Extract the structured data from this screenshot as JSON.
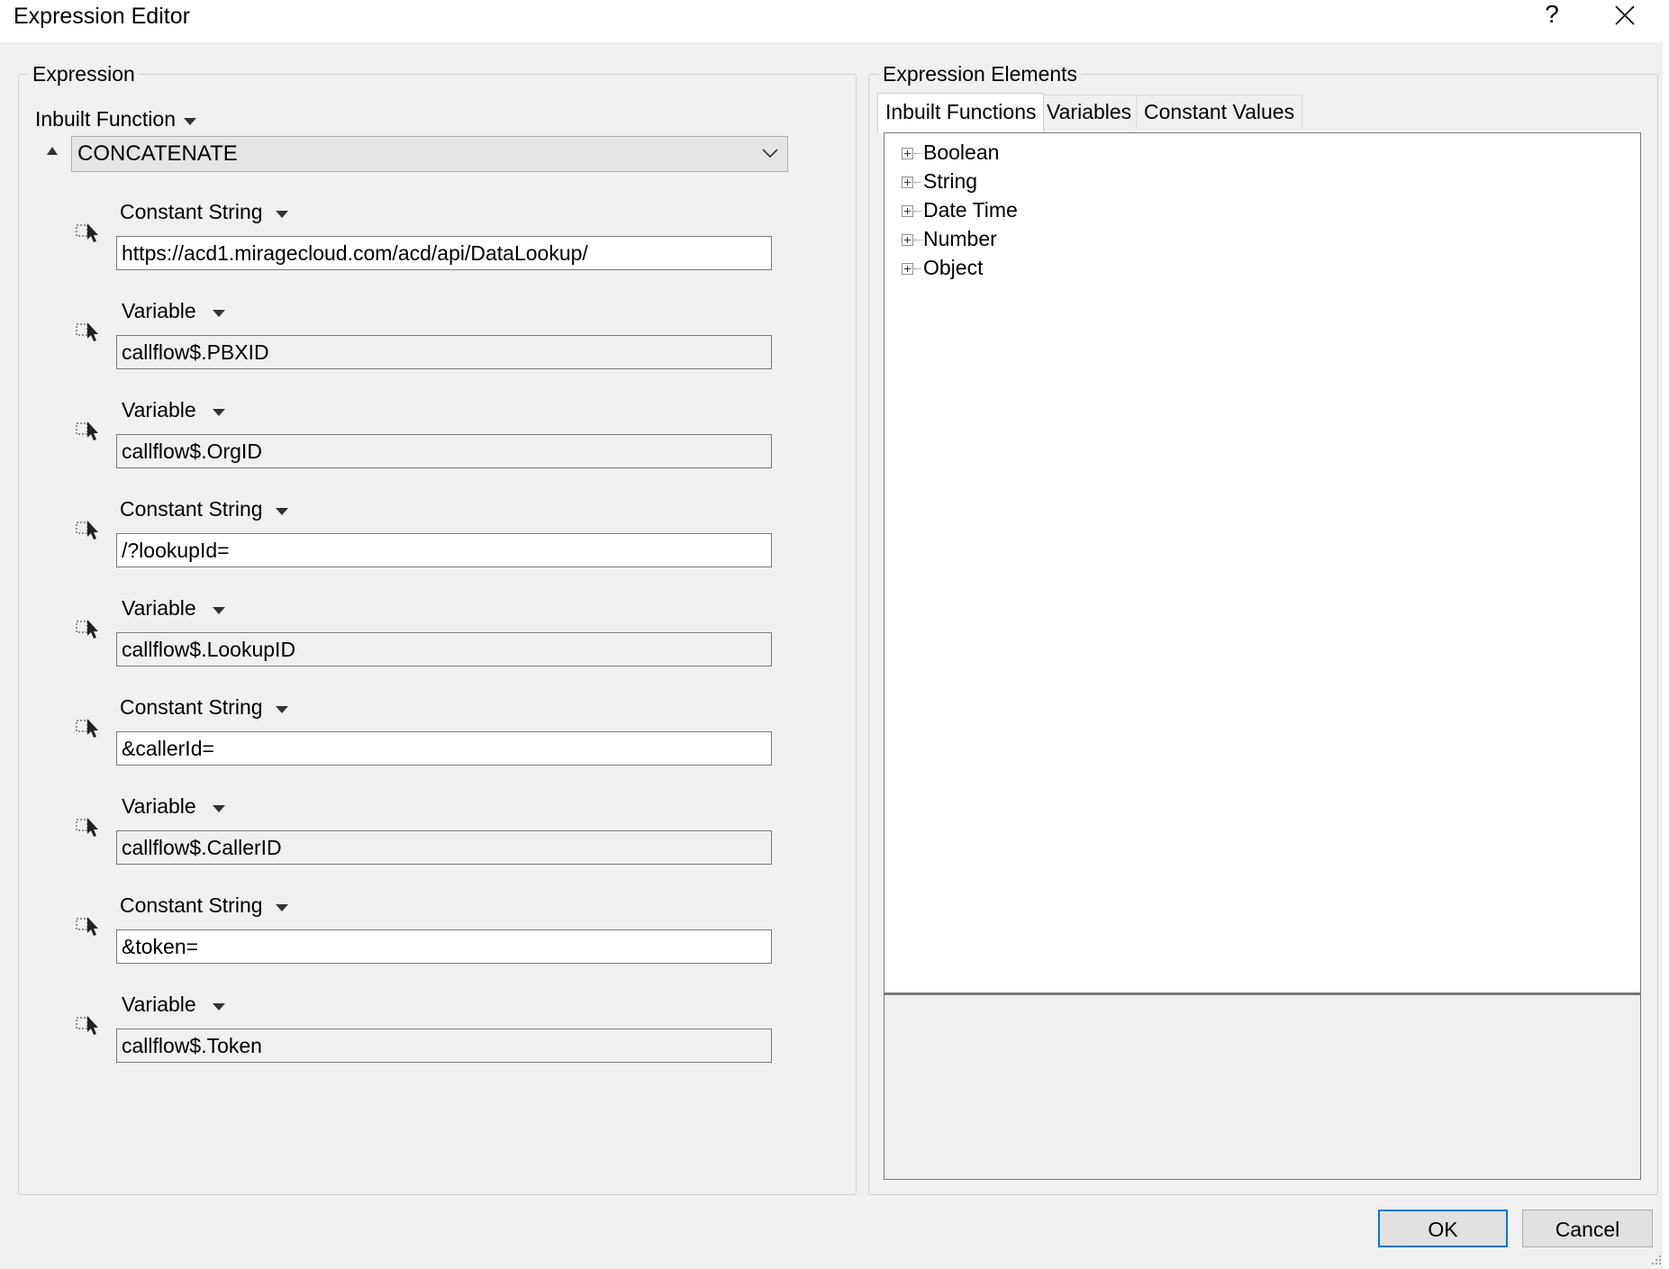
{
  "window": {
    "title": "Expression Editor",
    "help_label": "?"
  },
  "expression": {
    "group_label": "Expression",
    "function_type_label": "Inbuilt Function",
    "selected_function": "CONCATENATE",
    "arguments": [
      {
        "type": "Constant String",
        "kind": "const",
        "value": "https://acd1.miragecloud.com/acd/api/DataLookup/"
      },
      {
        "type": "Variable",
        "kind": "var",
        "value": "callflow$.PBXID"
      },
      {
        "type": "Variable",
        "kind": "var",
        "value": "callflow$.OrgID"
      },
      {
        "type": "Constant String",
        "kind": "const",
        "value": "/?lookupId="
      },
      {
        "type": "Variable",
        "kind": "var",
        "value": "callflow$.LookupID"
      },
      {
        "type": "Constant String",
        "kind": "const",
        "value": "&callerId="
      },
      {
        "type": "Variable",
        "kind": "var",
        "value": "callflow$.CallerID"
      },
      {
        "type": "Constant String",
        "kind": "const",
        "value": "&token="
      },
      {
        "type": "Variable",
        "kind": "var",
        "value": "callflow$.Token"
      }
    ]
  },
  "elements": {
    "group_label": "Expression Elements",
    "tabs": [
      {
        "label": "Inbuilt Functions",
        "active": true
      },
      {
        "label": "Variables",
        "active": false
      },
      {
        "label": "Constant Values",
        "active": false
      }
    ],
    "tree": [
      "Boolean",
      "String",
      "Date Time",
      "Number",
      "Object"
    ]
  },
  "buttons": {
    "ok": "OK",
    "cancel": "Cancel"
  },
  "colors": {
    "background": "#f0f0f0",
    "default_button_border": "#0078d7"
  }
}
